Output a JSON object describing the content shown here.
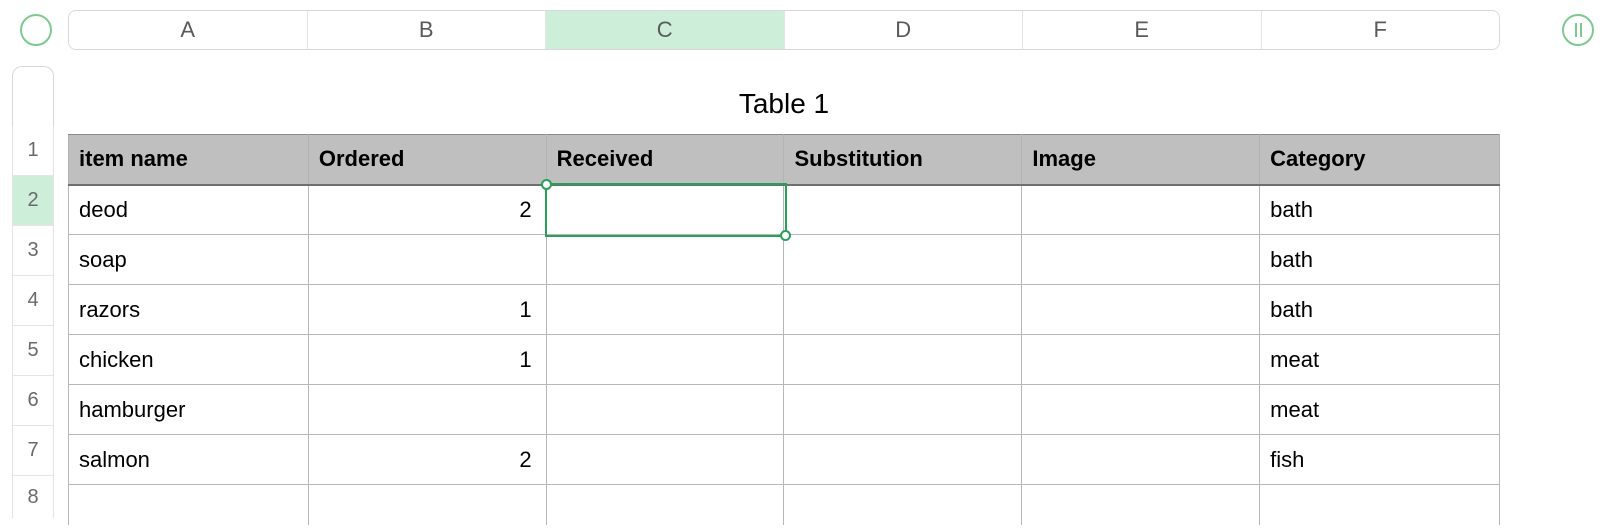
{
  "columns": [
    "A",
    "B",
    "C",
    "D",
    "E",
    "F"
  ],
  "selectedColumnIndex": 2,
  "rows": [
    "1",
    "2",
    "3",
    "4",
    "5",
    "6",
    "7",
    "8"
  ],
  "selectedRowIndex": 1,
  "title": "Table 1",
  "headers": {
    "a": "item name",
    "b": "Ordered",
    "c": "Received",
    "d": "Substitution",
    "e": "Image",
    "f": "Category"
  },
  "data": [
    {
      "item": "deod",
      "ordered": "2",
      "received": "",
      "substitution": "",
      "image": "",
      "category": "bath"
    },
    {
      "item": "soap",
      "ordered": "",
      "received": "",
      "substitution": "",
      "image": "",
      "category": "bath"
    },
    {
      "item": "razors",
      "ordered": "1",
      "received": "",
      "substitution": "",
      "image": "",
      "category": "bath"
    },
    {
      "item": "chicken",
      "ordered": "1",
      "received": "",
      "substitution": "",
      "image": "",
      "category": "meat"
    },
    {
      "item": "hamburger",
      "ordered": "",
      "received": "",
      "substitution": "",
      "image": "",
      "category": "meat"
    },
    {
      "item": "salmon",
      "ordered": "2",
      "received": "",
      "substitution": "",
      "image": "",
      "category": "fish"
    }
  ],
  "selectedCell": {
    "row": 2,
    "col": "C"
  }
}
